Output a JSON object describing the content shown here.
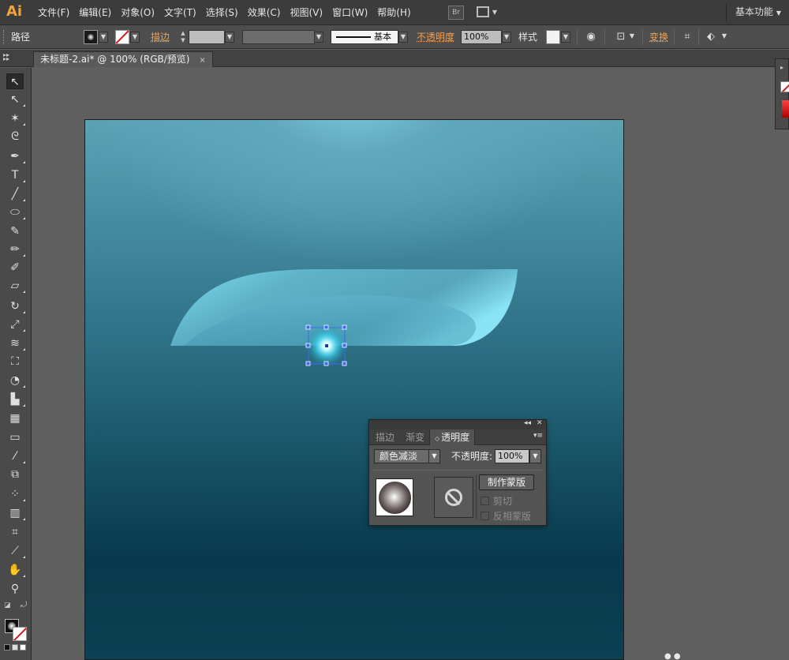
{
  "app": {
    "logo": "Ai",
    "menu": [
      "文件(F)",
      "编辑(E)",
      "对象(O)",
      "文字(T)",
      "选择(S)",
      "效果(C)",
      "视图(V)",
      "窗口(W)",
      "帮助(H)"
    ],
    "bridge_label": "Br",
    "workspace": "基本功能"
  },
  "control_bar": {
    "object_type": "路径",
    "stroke_label": "描边",
    "stroke_profile": "基本",
    "opacity_label": "不透明度",
    "opacity_value": "100%",
    "style_label": "样式",
    "transform_label": "变换"
  },
  "document_tab": {
    "title": "未标题-2.ai* @ 100% (RGB/预览)",
    "close": "×"
  },
  "tools": [
    "selection-tool",
    "direct-selection-tool",
    "magic-wand-tool",
    "lasso-tool",
    "pen-tool",
    "type-tool",
    "line-segment-tool",
    "ellipse-tool",
    "paintbrush-tool",
    "pencil-tool",
    "blob-brush-tool",
    "eraser-tool",
    "rotate-tool",
    "scale-tool",
    "warp-tool",
    "free-transform-tool",
    "shape-builder-tool",
    "perspective-grid-tool",
    "mesh-tool",
    "gradient-tool",
    "eyedropper-tool",
    "blend-tool",
    "symbol-sprayer-tool",
    "column-graph-tool",
    "artboard-tool",
    "slice-tool",
    "hand-tool",
    "zoom-tool"
  ],
  "transparency_panel": {
    "tabs": [
      "描边",
      "渐变",
      "透明度"
    ],
    "active_tab": "透明度",
    "blend_mode": "颜色减淡",
    "opacity_label": "不透明度:",
    "opacity_value": "100%",
    "make_mask_button": "制作蒙版",
    "clip_label": "剪切",
    "invert_mask_label": "反相蒙版",
    "clip_checked": false,
    "invert_checked": false
  },
  "colors": {
    "menu_bg": "#3c3c3c",
    "toolbar_bg": "#4a4a4a",
    "accent_orange": "#f0a050",
    "artboard_top": "#5aa3b5",
    "artboard_bottom": "#06394b",
    "shape_cyan": "#7fe3f5",
    "selection_blue": "#3c6cf0"
  }
}
